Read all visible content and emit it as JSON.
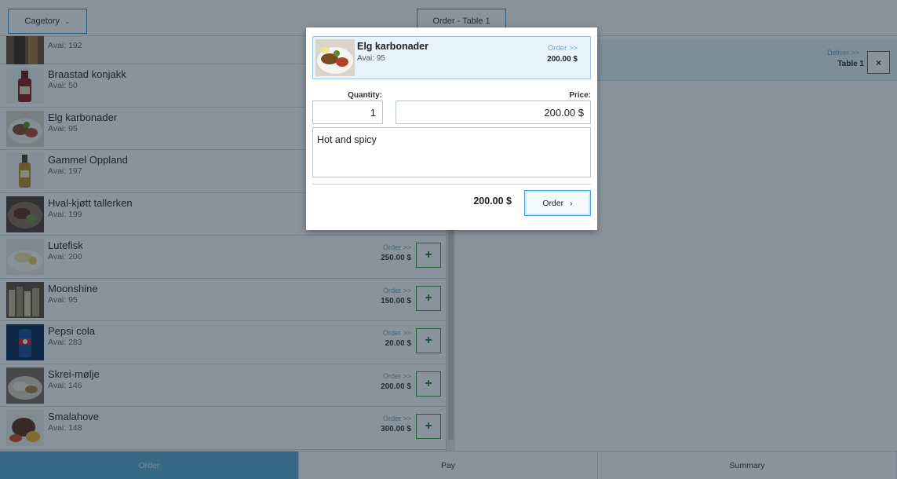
{
  "header": {
    "category_label": "Cagetory",
    "order_tab_label": "Order - Table 1"
  },
  "menu": {
    "items": [
      {
        "name": "",
        "avail": "Avai: 192",
        "thumb": "bottle-dark"
      },
      {
        "name": "Braastad konjakk",
        "avail": "Avai: 50",
        "thumb": "bottle-red"
      },
      {
        "name": "Elg karbonader",
        "avail": "Avai: 95",
        "thumb": "plate-meat"
      },
      {
        "name": "Gammel Oppland",
        "avail": "Avai: 197",
        "thumb": "bottle-amber"
      },
      {
        "name": "Hval-kjøtt tallerken",
        "avail": "Avai: 199",
        "thumb": "plate-dark"
      },
      {
        "name": "Lutefisk",
        "avail": "Avai: 200",
        "order": "Order >>",
        "price": "250.00 $",
        "thumb": "plate-fish"
      },
      {
        "name": "Moonshine",
        "avail": "Avai: 95",
        "order": "Order >>",
        "price": "150.00 $",
        "thumb": "bottles"
      },
      {
        "name": "Pepsi cola",
        "avail": "Avai: 283",
        "order": "Order >>",
        "price": "20.00 $",
        "thumb": "can-blue"
      },
      {
        "name": "Skrei-mølje",
        "avail": "Avai: 146",
        "order": "Order >>",
        "price": "200.00 $",
        "thumb": "plate-cod"
      },
      {
        "name": "Smalahove",
        "avail": "Avai: 148",
        "order": "Order >>",
        "price": "300.00 $",
        "thumb": "plate-head"
      }
    ],
    "plus_label": "+"
  },
  "order_panel": {
    "deliver_label": "Deliver >>",
    "table_label": "Table 1",
    "delete_label": "×"
  },
  "modal": {
    "product_name": "Elg karbonader",
    "product_avail": "Avai: 95",
    "product_order_link": "Order >>",
    "product_price": "200.00 $",
    "quantity_label": "Quantity:",
    "price_label": "Price:",
    "quantity_value": "1",
    "price_value": "200.00 $",
    "note_value": "Hot and spicy",
    "total": "200.00 $",
    "order_button_label": "Order",
    "order_button_arrow": "›"
  },
  "bottom_tabs": {
    "order": "Order",
    "pay": "Pay",
    "summary": "Summary"
  },
  "colors": {
    "accent": "#5ba8d4",
    "plus_border": "#3a9a3a",
    "delete_border": "#c0392b",
    "overlay": "rgba(20, 40, 55, 0.5)"
  }
}
